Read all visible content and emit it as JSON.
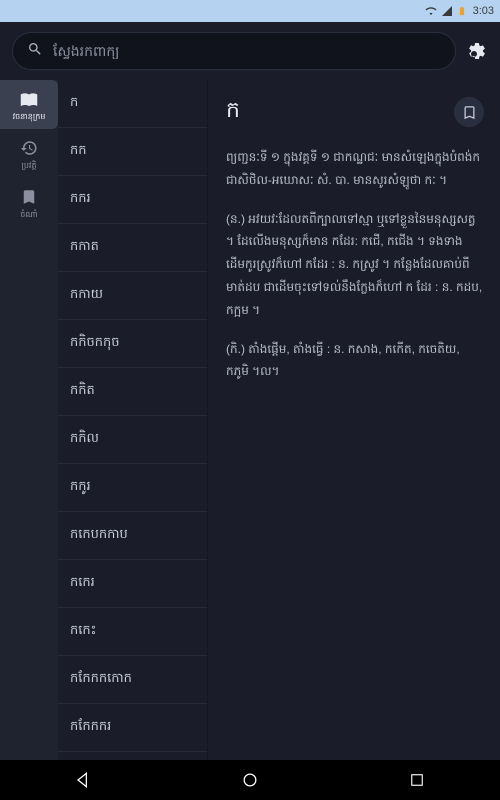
{
  "statusbar": {
    "time": "3:03"
  },
  "search": {
    "placeholder": "ស្វែងរកពាក្យ"
  },
  "nav": {
    "items": [
      {
        "id": "dictionary",
        "label": "វចនានុក្រម",
        "icon": "book-open-icon",
        "active": true
      },
      {
        "id": "history",
        "label": "ប្រវត្តិ",
        "icon": "history-icon",
        "active": false
      },
      {
        "id": "bookmarks",
        "label": "ចំណាំ",
        "icon": "bookmark-icon",
        "active": false
      }
    ]
  },
  "wordlist": [
    "ក",
    "កក",
    "កករ",
    "កកាត",
    "កកាយ",
    "កកិចកកុច",
    "កកិត",
    "កកិល",
    "កកូរ",
    "កកេបកកាប",
    "កកេរ",
    "កកេះ",
    "កកែកកកោក",
    "កកែកករ"
  ],
  "detail": {
    "title": "ក",
    "definitions": [
      "ព្យញ្ជនៈទី ១ ក្នុងវគ្គទី ១ ជាកណ្ឋជៈ មានសំឡេងក្នុងបំពង់ក ជាសិថិល-អឃោសៈ សំ. បា. មានសូរសំឡូថា កៈ ។",
      "(ន.) អវយវៈដែលតពីក្បាលទៅស្មា ឬទៅខ្លួននៃមនុស្សសត្វ ។ ដែលើងមនុស្សក៏មាន កដែរ: កជើ, កជើង ។ ទងទាងដើមកូរស្រូវក៏ហៅ កដែរ : ន. កស្រូវ ។ កន្លែងដែលគាប់ពីមាត់ដប ជាដើមចុះទៅទល់នឹងក្លែងក៏ហៅ ក ដែរ : ន. កដប, កក្អម ។",
      "(កិ.) តាំងផ្តើម, តាំងធ្វើ : ន. កសាង, កកើត, កចេតិយ, កភូមិ ។ល។"
    ]
  }
}
